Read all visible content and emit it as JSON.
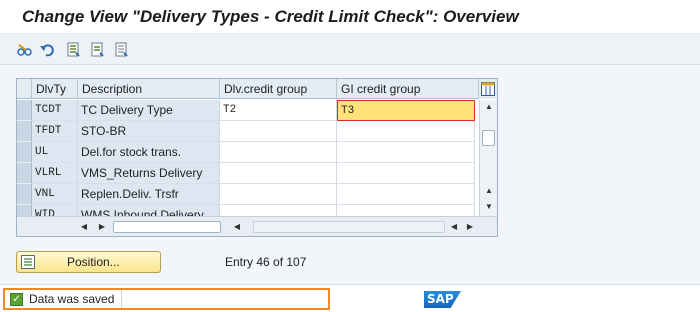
{
  "window": {
    "title": "Change View \"Delivery Types - Credit Limit Check\": Overview"
  },
  "toolbar": {
    "icons": [
      "edit-glasses-icon",
      "undo-icon",
      "select-all-icon",
      "select-block-icon",
      "deselect-all-icon"
    ]
  },
  "table": {
    "headers": [
      "DlvTy",
      "Description",
      "Dlv.credit group",
      "GI credit group"
    ],
    "rows": [
      {
        "type": "TCDT",
        "description": "TC Delivery Type",
        "dlv_credit_group": "T2",
        "gi_credit_group": "T3"
      },
      {
        "type": "TFDT",
        "description": "STO-BR",
        "dlv_credit_group": "",
        "gi_credit_group": ""
      },
      {
        "type": "UL",
        "description": "Del.for stock trans.",
        "dlv_credit_group": "",
        "gi_credit_group": ""
      },
      {
        "type": "VLRL",
        "description": "VMS_Returns Delivery",
        "dlv_credit_group": "",
        "gi_credit_group": ""
      },
      {
        "type": "VNL",
        "description": "Replen.Deliv. Trsfr",
        "dlv_credit_group": "",
        "gi_credit_group": ""
      },
      {
        "type": "WID",
        "description": "WMS Inbound Delivery",
        "dlv_credit_group": "",
        "gi_credit_group": ""
      }
    ]
  },
  "position_button": {
    "label": "Position..."
  },
  "entry_info": "Entry 46 of 107",
  "status": {
    "message": "Data was saved",
    "color": "#f08a24"
  },
  "logo": {
    "text": "SAP"
  }
}
